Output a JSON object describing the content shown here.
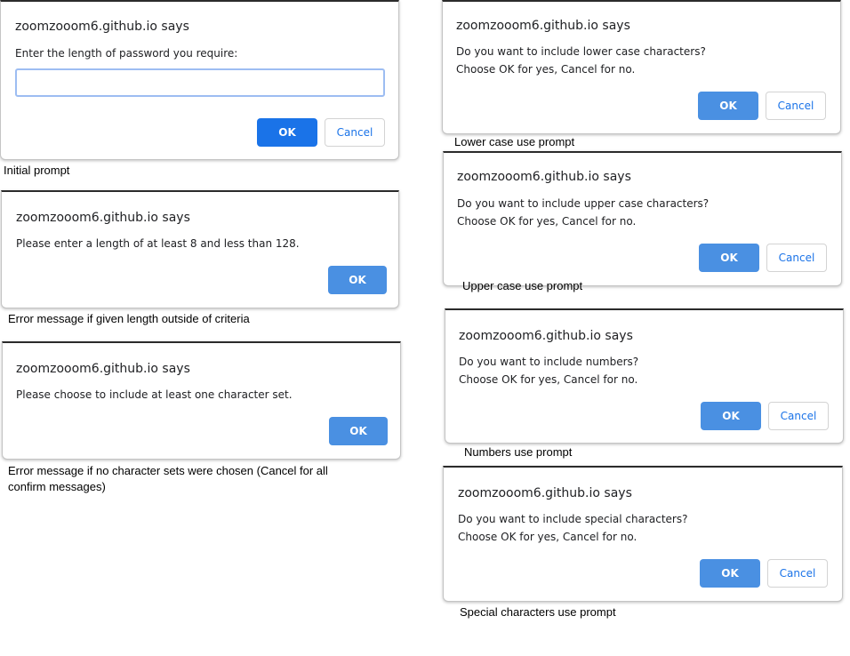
{
  "dialogs": {
    "initial": {
      "title": "zoomzooom6.github.io says",
      "line1": "Enter the length of password you require:",
      "input_value": "",
      "ok": "OK",
      "cancel": "Cancel",
      "caption": "Initial prompt"
    },
    "length_error": {
      "title": "zoomzooom6.github.io says",
      "line1": "Please enter a length of at least 8 and less than 128.",
      "ok": "OK",
      "caption": "Error message if given length outside of criteria"
    },
    "charset_error": {
      "title": "zoomzooom6.github.io says",
      "line1": "Please choose to include at least one character set.",
      "ok": "OK",
      "caption": "Error message if no character sets were chosen (Cancel for all confirm messages)"
    },
    "lower": {
      "title": "zoomzooom6.github.io says",
      "line1": "Do you want to include lower case characters?",
      "line2": "Choose OK for yes, Cancel for no.",
      "ok": "OK",
      "cancel": "Cancel",
      "caption": "Lower case use prompt"
    },
    "upper": {
      "title": "zoomzooom6.github.io says",
      "line1": "Do you want to include upper case characters?",
      "line2": "Choose OK for yes, Cancel for no.",
      "ok": "OK",
      "cancel": "Cancel",
      "caption": "Upper case use prompt"
    },
    "numbers": {
      "title": "zoomzooom6.github.io says",
      "line1": "Do you want to include numbers?",
      "line2": "Choose OK for yes, Cancel for no.",
      "ok": "OK",
      "cancel": "Cancel",
      "caption": "Numbers use prompt"
    },
    "special": {
      "title": "zoomzooom6.github.io says",
      "line1": "Do you want to include special characters?",
      "line2": "Choose OK for yes, Cancel for no.",
      "ok": "OK",
      "cancel": "Cancel",
      "caption": "Special characters use prompt"
    }
  }
}
